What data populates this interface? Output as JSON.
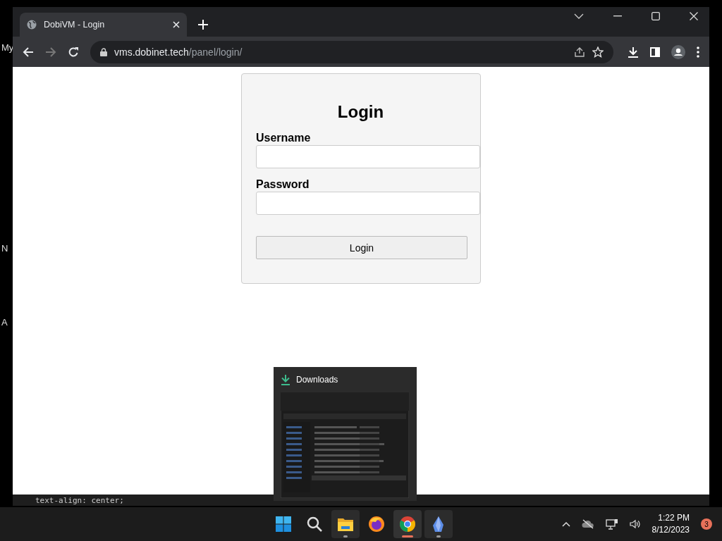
{
  "desktop": {
    "icon_labels": [
      "My",
      "N",
      "A"
    ]
  },
  "browser": {
    "tab": {
      "title": "DobiVM - Login",
      "selected": true
    },
    "url": {
      "host": "vms.dobinet.tech",
      "path": "/panel/login/"
    }
  },
  "login_form": {
    "title": "Login",
    "fields": [
      {
        "label": "Username"
      },
      {
        "label": "Password"
      }
    ],
    "button": "Login"
  },
  "background_editor": {
    "line": "text-align: center;"
  },
  "downloads_preview": {
    "title": "Downloads"
  },
  "taskbar": {
    "apps": [
      {
        "kind": "start",
        "running": false,
        "selected": false
      },
      {
        "kind": "search",
        "running": false,
        "selected": false
      },
      {
        "kind": "files",
        "running": true,
        "selected": false
      },
      {
        "kind": "firefox",
        "running": false,
        "selected": false
      },
      {
        "kind": "chrome",
        "running": true,
        "selected": true
      },
      {
        "kind": "app",
        "running": true,
        "selected": false
      }
    ],
    "clock": {
      "time": "1:22 PM",
      "date": "8/12/2023"
    },
    "notification_count": "3"
  }
}
